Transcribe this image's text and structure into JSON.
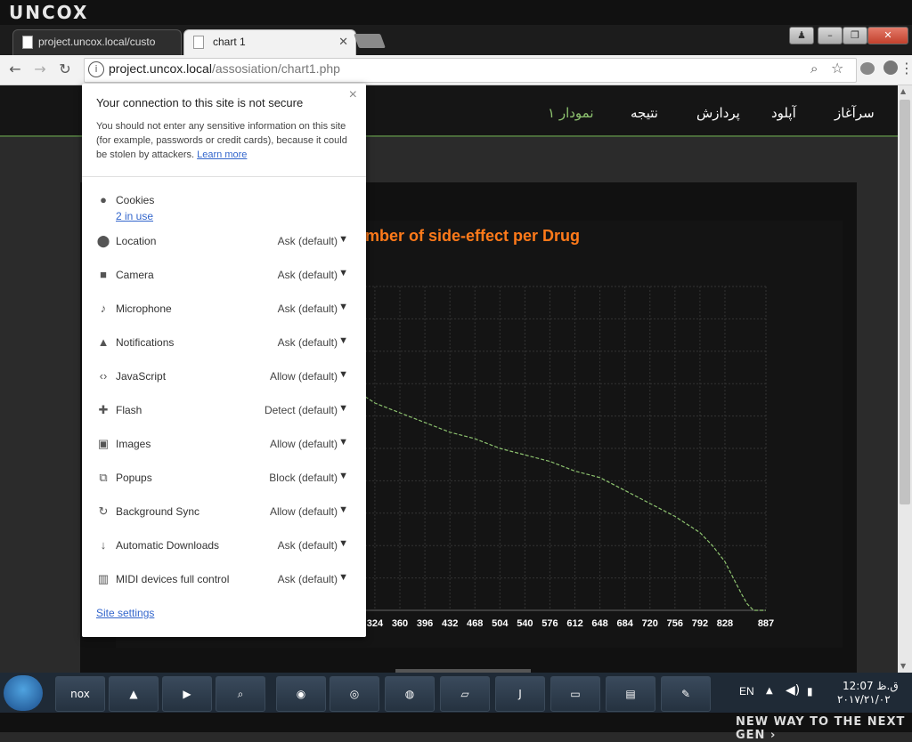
{
  "brand": {
    "logo_text": "UNCOX"
  },
  "tabs": [
    {
      "title": "project.uncox.local/custo",
      "active": false
    },
    {
      "title": "chart 1",
      "active": true
    }
  ],
  "toolbar": {
    "url_host": "project.uncox.local",
    "url_path": "/assosiation/chart1.php"
  },
  "site_nav": {
    "items": [
      "سرآغاز",
      "آپلود",
      "پردازش",
      "نتیجه",
      "نمودار ۱"
    ],
    "active": "نمودار ۱",
    "accent": "#8dc26f"
  },
  "chart_data": {
    "type": "line",
    "title": "mber of side-effect per Drug",
    "title_color": "#ff7a1a",
    "line_color": "#8dc26f",
    "grid": true,
    "x_ticks": [
      324,
      360,
      396,
      432,
      468,
      504,
      540,
      576,
      612,
      648,
      684,
      720,
      756,
      792,
      828,
      887
    ],
    "x": [
      310,
      324,
      360,
      396,
      432,
      468,
      504,
      540,
      576,
      612,
      648,
      684,
      720,
      756,
      792,
      810,
      828,
      840,
      852,
      860,
      869,
      887
    ],
    "y": [
      0.66,
      0.64,
      0.61,
      0.58,
      0.55,
      0.53,
      0.5,
      0.48,
      0.46,
      0.43,
      0.41,
      0.37,
      0.33,
      0.29,
      0.24,
      0.2,
      0.15,
      0.1,
      0.05,
      0.02,
      0.0,
      0.0
    ]
  },
  "popup": {
    "title": "Your connection to this site is not secure",
    "description": "You should not enter any sensitive information on this site (for example, passwords or credit cards), because it could be stolen by attackers.",
    "learn_more": "Learn more",
    "cookies_label": "Cookies",
    "cookies_sub": "2 in use",
    "permissions": [
      {
        "icon": "location-icon",
        "glyph": "⬤",
        "label": "Location",
        "value": "Ask (default)"
      },
      {
        "icon": "camera-icon",
        "glyph": "■",
        "label": "Camera",
        "value": "Ask (default)"
      },
      {
        "icon": "microphone-icon",
        "glyph": "♪",
        "label": "Microphone",
        "value": "Ask (default)"
      },
      {
        "icon": "bell-icon",
        "glyph": "▲",
        "label": "Notifications",
        "value": "Ask (default)"
      },
      {
        "icon": "code-icon",
        "glyph": "‹›",
        "label": "JavaScript",
        "value": "Allow (default)"
      },
      {
        "icon": "puzzle-icon",
        "glyph": "✚",
        "label": "Flash",
        "value": "Detect (default)"
      },
      {
        "icon": "image-icon",
        "glyph": "▣",
        "label": "Images",
        "value": "Allow (default)"
      },
      {
        "icon": "popup-blocked-icon",
        "glyph": "⧉",
        "label": "Popups",
        "value": "Block (default)"
      },
      {
        "icon": "sync-icon",
        "glyph": "↻",
        "label": "Background Sync",
        "value": "Allow (default)"
      },
      {
        "icon": "download-icon",
        "glyph": "↓",
        "label": "Automatic Downloads",
        "value": "Ask (default)"
      },
      {
        "icon": "midi-icon",
        "glyph": "▥",
        "label": "MIDI devices full control",
        "value": "Ask (default)"
      }
    ],
    "site_settings": "Site settings"
  },
  "taskbar": {
    "lang": "EN",
    "time": "12:07 ق.ظ",
    "date": "۲۰۱۷/۲۱/۰۲"
  },
  "footer": {
    "tagline": "NEW WAY TO THE NEXT GEN ›"
  }
}
